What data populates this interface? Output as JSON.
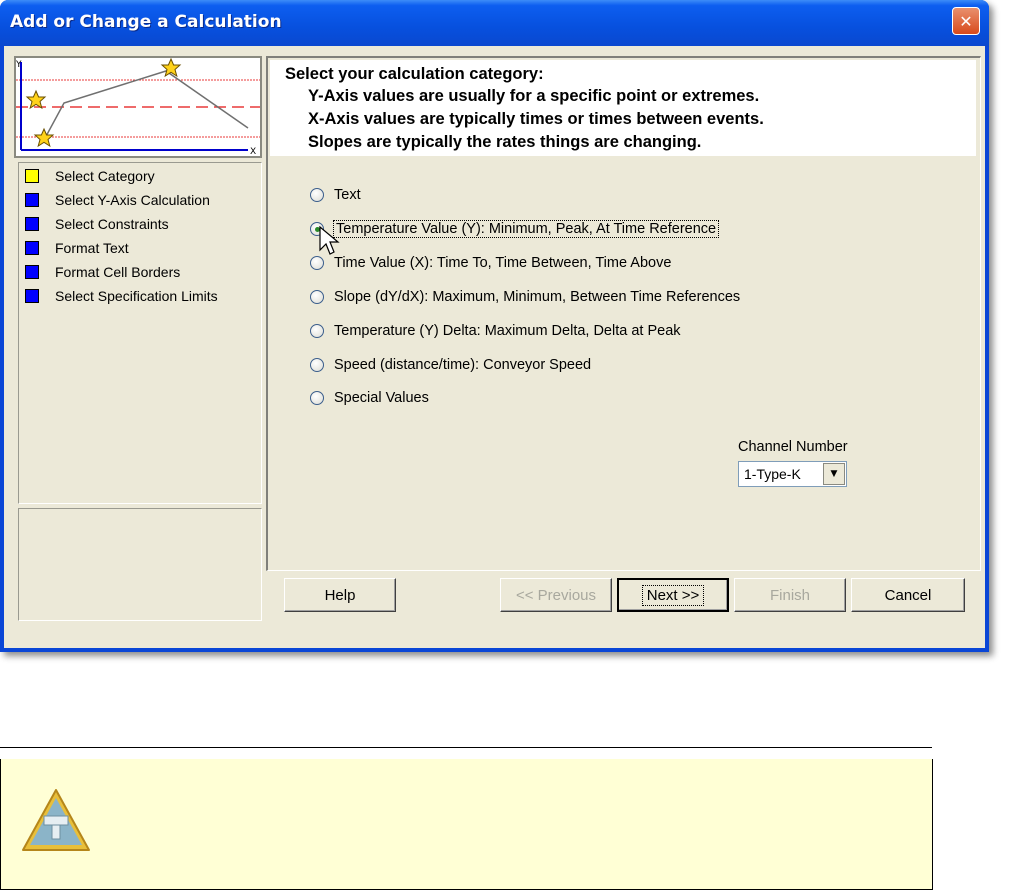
{
  "window": {
    "title": "Add or Change a Calculation"
  },
  "icons": {
    "close": "close-icon",
    "warning": "warning-triangle-icon",
    "cursor": "mouse-pointer-icon"
  },
  "colors": {
    "title_bar": "#0a46d6",
    "step_current": "#ffff00",
    "step_pending": "#0000ff",
    "note_background": "#ffffd5"
  },
  "graph": {
    "y_label": "Y",
    "x_label": "X"
  },
  "steps": [
    {
      "label": "Select Category",
      "current": true
    },
    {
      "label": "Select Y-Axis Calculation",
      "current": false
    },
    {
      "label": "Select Constraints",
      "current": false
    },
    {
      "label": "Format Text",
      "current": false
    },
    {
      "label": "Format Cell Borders",
      "current": false
    },
    {
      "label": "Select Specification Limits",
      "current": false
    }
  ],
  "header": {
    "line1": "Select your calculation category:",
    "line2": "Y-Axis values are usually for a specific point or extremes.",
    "line3": "X-Axis values are typically times or times between events.",
    "line4": "Slopes are typically the rates things are changing."
  },
  "options": [
    {
      "label": "Text",
      "selected": false
    },
    {
      "label": "Temperature Value (Y):  Minimum, Peak, At Time Reference",
      "selected": true
    },
    {
      "label": "Time Value (X):  Time To, Time Between, Time Above",
      "selected": false
    },
    {
      "label": "Slope (dY/dX):  Maximum, Minimum, Between Time References",
      "selected": false
    },
    {
      "label": "Temperature (Y) Delta:  Maximum Delta, Delta at Peak",
      "selected": false
    },
    {
      "label": "Speed (distance/time): Conveyor Speed",
      "selected": false
    },
    {
      "label": "Special  Values",
      "selected": false
    }
  ],
  "channel": {
    "label": "Channel Number",
    "value": "1-Type-K"
  },
  "buttons": {
    "help": "Help",
    "previous": "<< Previous",
    "next": "Next >>",
    "finish": "Finish",
    "cancel": "Cancel"
  }
}
